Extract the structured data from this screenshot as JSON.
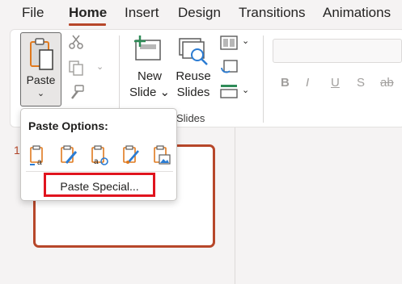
{
  "tabs": [
    {
      "label": "File"
    },
    {
      "label": "Home",
      "active": true
    },
    {
      "label": "Insert"
    },
    {
      "label": "Design"
    },
    {
      "label": "Transitions"
    },
    {
      "label": "Animations"
    }
  ],
  "clipboard": {
    "paste_label": "Paste",
    "paste_chevron": "⌄"
  },
  "slides_group": {
    "new_slide_line1": "New",
    "new_slide_line2": "Slide ⌄",
    "reuse_slides_line1": "Reuse",
    "reuse_slides_line2": "Slides",
    "group_label": "Slides"
  },
  "font_format": {
    "bold": "B",
    "italic": "I",
    "underline": "U",
    "shadow": "S",
    "strikethrough": "ab"
  },
  "slide_panel": {
    "slide_number": "1"
  },
  "paste_dropdown": {
    "title": "Paste Options:",
    "options": [
      {
        "icon": "use-destination-theme-icon"
      },
      {
        "icon": "keep-source-formatting-icon"
      },
      {
        "icon": "embed-icon"
      },
      {
        "icon": "picture-icon"
      },
      {
        "icon": "keep-text-only-icon"
      }
    ],
    "paste_special_label": "Paste Special..."
  },
  "colors": {
    "accent": "#b7472a",
    "highlight": "#e0141e"
  }
}
